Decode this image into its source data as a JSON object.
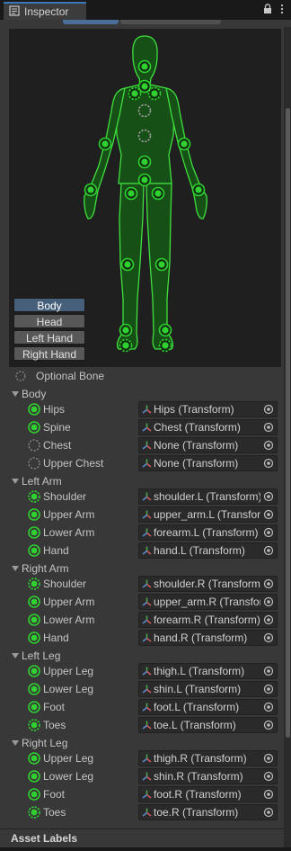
{
  "window": {
    "tab_title": "Inspector"
  },
  "modes": {
    "items": [
      {
        "label": "Body",
        "active": true
      },
      {
        "label": "Head",
        "active": false
      },
      {
        "label": "Left Hand",
        "active": false
      },
      {
        "label": "Right Hand",
        "active": false
      }
    ]
  },
  "legend": {
    "optional_label": "Optional Bone"
  },
  "groups": [
    {
      "label": "Body",
      "rows": [
        {
          "label": "Hips",
          "value": "Hips (Transform)",
          "state": "assigned"
        },
        {
          "label": "Spine",
          "value": "Chest (Transform)",
          "state": "assigned"
        },
        {
          "label": "Chest",
          "value": "None (Transform)",
          "state": "optional"
        },
        {
          "label": "Upper Chest",
          "value": "None (Transform)",
          "state": "optional"
        }
      ]
    },
    {
      "label": "Left Arm",
      "rows": [
        {
          "label": "Shoulder",
          "value": "shoulder.L (Transform)",
          "state": "optional-filled"
        },
        {
          "label": "Upper Arm",
          "value": "upper_arm.L (Transform)",
          "state": "assigned"
        },
        {
          "label": "Lower Arm",
          "value": "forearm.L (Transform)",
          "state": "assigned"
        },
        {
          "label": "Hand",
          "value": "hand.L (Transform)",
          "state": "assigned"
        }
      ]
    },
    {
      "label": "Right Arm",
      "rows": [
        {
          "label": "Shoulder",
          "value": "shoulder.R (Transform)",
          "state": "optional-filled"
        },
        {
          "label": "Upper Arm",
          "value": "upper_arm.R (Transform)",
          "state": "assigned"
        },
        {
          "label": "Lower Arm",
          "value": "forearm.R (Transform)",
          "state": "assigned"
        },
        {
          "label": "Hand",
          "value": "hand.R (Transform)",
          "state": "assigned"
        }
      ]
    },
    {
      "label": "Left Leg",
      "rows": [
        {
          "label": "Upper Leg",
          "value": "thigh.L (Transform)",
          "state": "assigned"
        },
        {
          "label": "Lower Leg",
          "value": "shin.L (Transform)",
          "state": "assigned"
        },
        {
          "label": "Foot",
          "value": "foot.L (Transform)",
          "state": "assigned"
        },
        {
          "label": "Toes",
          "value": "toe.L (Transform)",
          "state": "optional-filled"
        }
      ]
    },
    {
      "label": "Right Leg",
      "rows": [
        {
          "label": "Upper Leg",
          "value": "thigh.R (Transform)",
          "state": "assigned"
        },
        {
          "label": "Lower Leg",
          "value": "shin.R (Transform)",
          "state": "assigned"
        },
        {
          "label": "Foot",
          "value": "foot.R (Transform)",
          "state": "assigned"
        },
        {
          "label": "Toes",
          "value": "toe.R (Transform)",
          "state": "optional-filled"
        }
      ]
    }
  ],
  "footer": {
    "asset_labels": "Asset Labels"
  },
  "colors": {
    "bone_green": "#2fd02f",
    "bone_outline": "#3fe03f",
    "body_fill": "#175017",
    "active_mode": "#46607c"
  }
}
